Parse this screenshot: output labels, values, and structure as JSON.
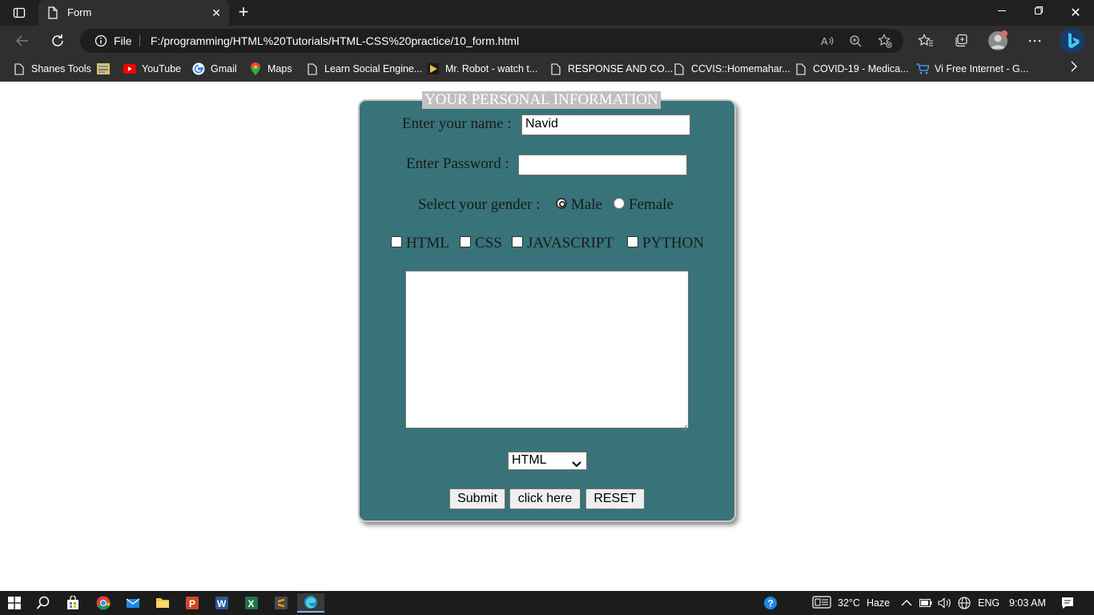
{
  "browser": {
    "tab_title": "Form",
    "address": {
      "scheme_label": "File",
      "url": "F:/programming/HTML%20Tutorials/HTML-CSS%20practice/10_form.html"
    },
    "bookmarks": [
      {
        "label": "Shanes Tools",
        "icon": "page-icon"
      },
      {
        "label": "",
        "icon": "image-bookmark-icon"
      },
      {
        "label": "YouTube",
        "icon": "youtube-icon"
      },
      {
        "label": "Gmail",
        "icon": "google-icon"
      },
      {
        "label": "Maps",
        "icon": "maps-icon"
      },
      {
        "label": "Learn Social Engine...",
        "icon": "page-icon"
      },
      {
        "label": "Mr. Robot - watch t...",
        "icon": "play-icon"
      },
      {
        "label": "RESPONSE AND CO...",
        "icon": "page-icon"
      },
      {
        "label": "CCVIS::Homemahar...",
        "icon": "page-icon"
      },
      {
        "label": "COVID-19 - Medica...",
        "icon": "page-icon"
      },
      {
        "label": "Vi Free Internet - G...",
        "icon": "cart-icon"
      }
    ]
  },
  "form": {
    "legend": "YOUR PERSONAL INFORMATION",
    "name_label": "Enter your name :",
    "name_value": "Navid",
    "password_label": "Enter Password :",
    "gender_label": "Select your gender :",
    "gender_options": [
      {
        "label": "Male",
        "checked": true
      },
      {
        "label": "Female",
        "checked": false
      }
    ],
    "skills": [
      "HTML",
      "CSS",
      "JAVASCRIPT",
      "PYTHON"
    ],
    "select_value": "HTML",
    "buttons": {
      "submit": "Submit",
      "click": "click here",
      "reset": "RESET"
    },
    "colors": {
      "panel": "#38737a",
      "legend_bg": "#c0c0c0"
    }
  },
  "taskbar": {
    "weather": "32°C",
    "weather_desc": "Haze",
    "language": "ENG",
    "time": "9:03 AM"
  }
}
